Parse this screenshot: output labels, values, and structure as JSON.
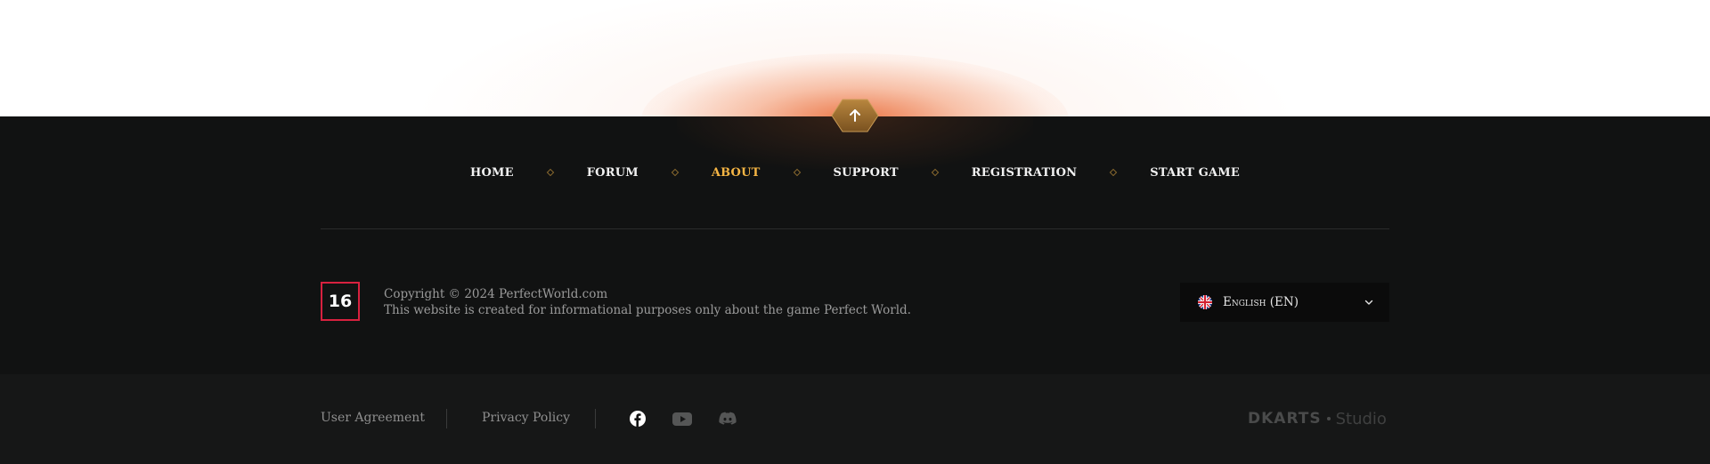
{
  "nav": {
    "items": [
      {
        "label": "HOME"
      },
      {
        "label": "FORUM"
      },
      {
        "label": "ABOUT",
        "active": true
      },
      {
        "label": "SUPPORT"
      },
      {
        "label": "REGISTRATION"
      },
      {
        "label": "START GAME"
      }
    ]
  },
  "age_rating": "16",
  "copyright": {
    "line1": "Copyright © 2024 PerfectWorld.com",
    "line2": "This website is created for informational purposes only about the game Perfect World."
  },
  "language": {
    "selected": "English (EN)",
    "flag_icon": "uk-flag-icon"
  },
  "bottom_links": {
    "user_agreement": "User Agreement",
    "privacy_policy": "Privacy Policy"
  },
  "social": [
    "facebook-icon",
    "youtube-icon",
    "discord-icon"
  ],
  "studio": {
    "brand": "DKARTS",
    "name": "Studio"
  },
  "colors": {
    "accent": "#f5b544",
    "glow": "#e8682a",
    "footer_bg": "#111212",
    "bottom_bg": "#161717",
    "age_border": "#d8213f"
  }
}
